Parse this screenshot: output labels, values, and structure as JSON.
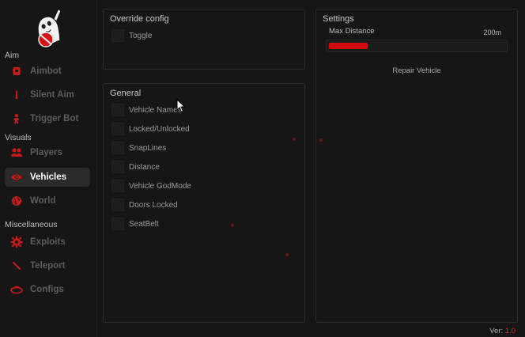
{
  "sidebar": {
    "sections": [
      {
        "label": "Aim"
      },
      {
        "label": "Visuals"
      },
      {
        "label": "Miscellaneous"
      }
    ],
    "items": [
      {
        "label": "Aimbot",
        "icon": "aimbot-icon"
      },
      {
        "label": "Silent Aim",
        "icon": "bullet-icon"
      },
      {
        "label": "Trigger Bot",
        "icon": "trigger-bot-icon"
      },
      {
        "label": "Players",
        "icon": "users-icon"
      },
      {
        "label": "Vehicles",
        "icon": "eye-icon"
      },
      {
        "label": "World",
        "icon": "globe-icon"
      },
      {
        "label": "Exploits",
        "icon": "gear-icon"
      },
      {
        "label": "Teleport",
        "icon": "teleport-icon"
      },
      {
        "label": "Configs",
        "icon": "configs-icon"
      }
    ],
    "active_item": "Vehicles"
  },
  "override": {
    "title": "Override config",
    "toggle_label": "Toggle"
  },
  "general": {
    "title": "General",
    "options": [
      "Vehicle Names",
      "Locked/Unlocked",
      "SnapLines",
      "Distance",
      "Vehicle GodMode",
      "Doors Locked",
      "SeatBelt"
    ]
  },
  "settings": {
    "title": "Settings",
    "slider_label": "Max Distance",
    "slider_value": "200m",
    "slider_fill_fraction": 0.22,
    "repair_button": "Repair Vehicle"
  },
  "version": {
    "prefix": "Ver: ",
    "number": "1.0"
  },
  "colors": {
    "accent": "#e8261b",
    "background": "#161616"
  }
}
